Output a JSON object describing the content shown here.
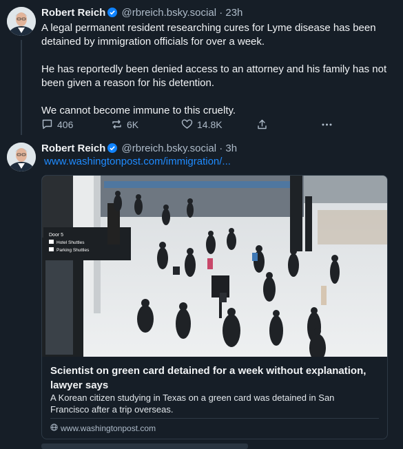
{
  "posts": [
    {
      "author": "Robert Reich",
      "handle": "@rbreich.bsky.social",
      "time": "23h",
      "paragraphs": [
        "A legal permanent resident researching cures for Lyme disease has been detained by immigration officials for over a week.",
        "He has reportedly been denied access to an attorney and his family has not been given a reason for his detention.",
        "We cannot become immune to this cruelty."
      ],
      "replies": "406",
      "reposts": "6K",
      "likes": "14.8K"
    },
    {
      "author": "Robert Reich",
      "handle": "@rbreich.bsky.social",
      "time": "3h",
      "link": "www.washingtonpost.com/immigration/...",
      "card": {
        "title": "Scientist on green card detained for a week without explanation, lawyer says",
        "description": "A Korean citizen studying in Texas on a green card was detained in San Francisco after a trip overseas.",
        "domain": "www.washingtonpost.com",
        "sign": {
          "line1": "Door 5",
          "line2": "Hotel Shuttles",
          "line3": "Parking Shuttles"
        }
      }
    }
  ],
  "separator": " · ",
  "colors": {
    "background": "#161e27",
    "link": "#1f8bff",
    "verified": "#1083fe",
    "muted": "#aebbc9"
  },
  "icons": [
    "reply-icon",
    "repost-icon",
    "like-icon",
    "share-icon",
    "more-icon",
    "verified-icon",
    "globe-icon"
  ]
}
